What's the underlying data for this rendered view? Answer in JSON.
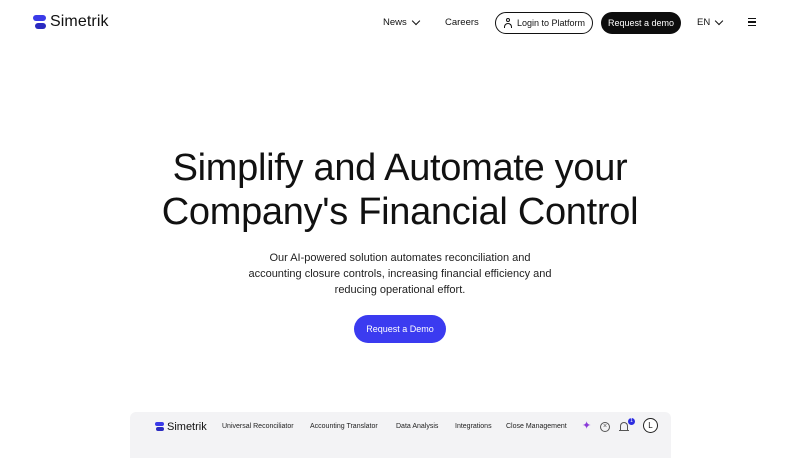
{
  "header": {
    "logo_text": "Simetrik",
    "nav": [
      {
        "label": "News"
      },
      {
        "label": "Careers"
      }
    ],
    "login_label": "Login to Platform",
    "demo_label": "Request a demo",
    "language": "EN"
  },
  "hero": {
    "title_line1": "Simplify and Automate your",
    "title_line2": "Company's Financial Control",
    "sub_line1": "Our AI-powered solution automates reconciliation and",
    "sub_line2": "accounting closure controls, increasing financial efficiency and",
    "sub_line3": "reducing operational effort.",
    "cta_label": "Request a Demo"
  },
  "preview": {
    "logo_text": "Simetrik",
    "nav": [
      {
        "label": "Universal Reconciliator"
      },
      {
        "label": "Accounting Translator"
      },
      {
        "label": "Data Analysis"
      },
      {
        "label": "Integrations"
      },
      {
        "label": "Close Management"
      }
    ],
    "notification_count": "1",
    "avatar_initial": "L"
  },
  "colors": {
    "brand_blue": "#3b3bf0",
    "dark": "#0d0d0d",
    "preview_bg": "#f3f3f5"
  }
}
